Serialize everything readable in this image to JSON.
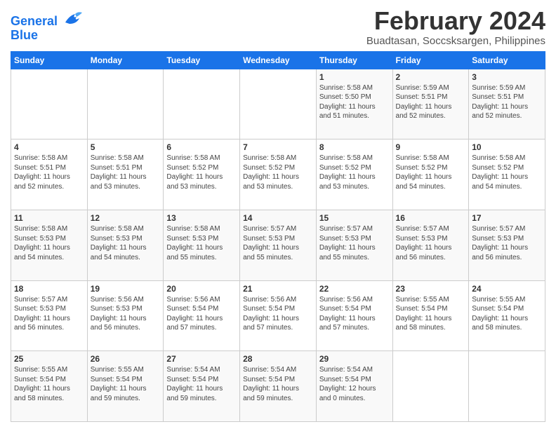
{
  "logo": {
    "line1": "General",
    "line2": "Blue"
  },
  "title": "February 2024",
  "subtitle": "Buadtasan, Soccsksargen, Philippines",
  "days_of_week": [
    "Sunday",
    "Monday",
    "Tuesday",
    "Wednesday",
    "Thursday",
    "Friday",
    "Saturday"
  ],
  "weeks": [
    [
      {
        "day": "",
        "info": ""
      },
      {
        "day": "",
        "info": ""
      },
      {
        "day": "",
        "info": ""
      },
      {
        "day": "",
        "info": ""
      },
      {
        "day": "1",
        "info": "Sunrise: 5:58 AM\nSunset: 5:50 PM\nDaylight: 11 hours\nand 51 minutes."
      },
      {
        "day": "2",
        "info": "Sunrise: 5:59 AM\nSunset: 5:51 PM\nDaylight: 11 hours\nand 52 minutes."
      },
      {
        "day": "3",
        "info": "Sunrise: 5:59 AM\nSunset: 5:51 PM\nDaylight: 11 hours\nand 52 minutes."
      }
    ],
    [
      {
        "day": "4",
        "info": "Sunrise: 5:58 AM\nSunset: 5:51 PM\nDaylight: 11 hours\nand 52 minutes."
      },
      {
        "day": "5",
        "info": "Sunrise: 5:58 AM\nSunset: 5:51 PM\nDaylight: 11 hours\nand 53 minutes."
      },
      {
        "day": "6",
        "info": "Sunrise: 5:58 AM\nSunset: 5:52 PM\nDaylight: 11 hours\nand 53 minutes."
      },
      {
        "day": "7",
        "info": "Sunrise: 5:58 AM\nSunset: 5:52 PM\nDaylight: 11 hours\nand 53 minutes."
      },
      {
        "day": "8",
        "info": "Sunrise: 5:58 AM\nSunset: 5:52 PM\nDaylight: 11 hours\nand 53 minutes."
      },
      {
        "day": "9",
        "info": "Sunrise: 5:58 AM\nSunset: 5:52 PM\nDaylight: 11 hours\nand 54 minutes."
      },
      {
        "day": "10",
        "info": "Sunrise: 5:58 AM\nSunset: 5:52 PM\nDaylight: 11 hours\nand 54 minutes."
      }
    ],
    [
      {
        "day": "11",
        "info": "Sunrise: 5:58 AM\nSunset: 5:53 PM\nDaylight: 11 hours\nand 54 minutes."
      },
      {
        "day": "12",
        "info": "Sunrise: 5:58 AM\nSunset: 5:53 PM\nDaylight: 11 hours\nand 54 minutes."
      },
      {
        "day": "13",
        "info": "Sunrise: 5:58 AM\nSunset: 5:53 PM\nDaylight: 11 hours\nand 55 minutes."
      },
      {
        "day": "14",
        "info": "Sunrise: 5:57 AM\nSunset: 5:53 PM\nDaylight: 11 hours\nand 55 minutes."
      },
      {
        "day": "15",
        "info": "Sunrise: 5:57 AM\nSunset: 5:53 PM\nDaylight: 11 hours\nand 55 minutes."
      },
      {
        "day": "16",
        "info": "Sunrise: 5:57 AM\nSunset: 5:53 PM\nDaylight: 11 hours\nand 56 minutes."
      },
      {
        "day": "17",
        "info": "Sunrise: 5:57 AM\nSunset: 5:53 PM\nDaylight: 11 hours\nand 56 minutes."
      }
    ],
    [
      {
        "day": "18",
        "info": "Sunrise: 5:57 AM\nSunset: 5:53 PM\nDaylight: 11 hours\nand 56 minutes."
      },
      {
        "day": "19",
        "info": "Sunrise: 5:56 AM\nSunset: 5:53 PM\nDaylight: 11 hours\nand 56 minutes."
      },
      {
        "day": "20",
        "info": "Sunrise: 5:56 AM\nSunset: 5:54 PM\nDaylight: 11 hours\nand 57 minutes."
      },
      {
        "day": "21",
        "info": "Sunrise: 5:56 AM\nSunset: 5:54 PM\nDaylight: 11 hours\nand 57 minutes."
      },
      {
        "day": "22",
        "info": "Sunrise: 5:56 AM\nSunset: 5:54 PM\nDaylight: 11 hours\nand 57 minutes."
      },
      {
        "day": "23",
        "info": "Sunrise: 5:55 AM\nSunset: 5:54 PM\nDaylight: 11 hours\nand 58 minutes."
      },
      {
        "day": "24",
        "info": "Sunrise: 5:55 AM\nSunset: 5:54 PM\nDaylight: 11 hours\nand 58 minutes."
      }
    ],
    [
      {
        "day": "25",
        "info": "Sunrise: 5:55 AM\nSunset: 5:54 PM\nDaylight: 11 hours\nand 58 minutes."
      },
      {
        "day": "26",
        "info": "Sunrise: 5:55 AM\nSunset: 5:54 PM\nDaylight: 11 hours\nand 59 minutes."
      },
      {
        "day": "27",
        "info": "Sunrise: 5:54 AM\nSunset: 5:54 PM\nDaylight: 11 hours\nand 59 minutes."
      },
      {
        "day": "28",
        "info": "Sunrise: 5:54 AM\nSunset: 5:54 PM\nDaylight: 11 hours\nand 59 minutes."
      },
      {
        "day": "29",
        "info": "Sunrise: 5:54 AM\nSunset: 5:54 PM\nDaylight: 12 hours\nand 0 minutes."
      },
      {
        "day": "",
        "info": ""
      },
      {
        "day": "",
        "info": ""
      }
    ]
  ]
}
